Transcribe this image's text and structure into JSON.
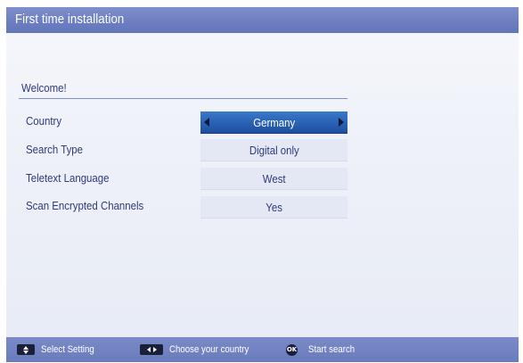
{
  "window": {
    "title": "First time installation"
  },
  "welcome": "Welcome!",
  "settings": [
    {
      "label": "Country",
      "value": "Germany",
      "selected": true
    },
    {
      "label": "Search Type",
      "value": "Digital only",
      "selected": false
    },
    {
      "label": "Teletext Language",
      "value": "West",
      "selected": false
    },
    {
      "label": "Scan Encrypted Channels",
      "value": "Yes",
      "selected": false
    }
  ],
  "footer": {
    "hints": [
      {
        "key": "up-down-key-icon",
        "label": "Select Setting"
      },
      {
        "key": "left-right-key-icon",
        "label": "Choose your country"
      },
      {
        "key": "ok-key-icon",
        "key_text": "OK",
        "label": "Start search"
      }
    ]
  },
  "colors": {
    "title_bar": "#6c7dc0",
    "selected_value": "#2b63b6",
    "text": "#2f3a78"
  }
}
